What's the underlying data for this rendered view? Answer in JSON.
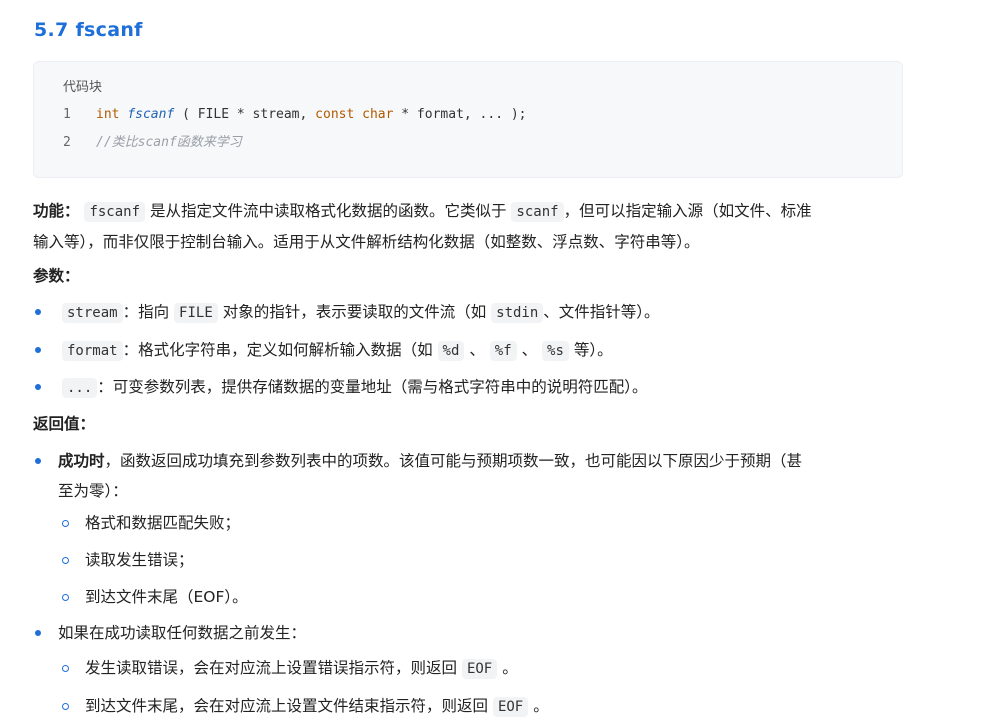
{
  "heading": "5.7 fscanf",
  "code_block": {
    "title": "代码块",
    "line1": {
      "num": "1",
      "kw1": "int",
      "fn": "fscanf",
      "rest1": " ( FILE * stream, ",
      "kw2": "const",
      "sp": " ",
      "kw3": "char",
      "rest2": " * format, ... );"
    },
    "line2": {
      "num": "2",
      "comment": "//类比scanf函数来学习"
    }
  },
  "function_para": {
    "label": "功能：",
    "code1": "fscanf",
    "text1": "是从指定文件流中读取格式化数据的函数。它类似于",
    "code2": "scanf",
    "text2": "，但可以指定输入源（如文件、标准",
    "text3": "输入等），而非仅限于控制台输入。适用于从文件解析结构化数据（如整数、浮点数、字符串等）。"
  },
  "params_heading": "参数：",
  "params": [
    {
      "code": "stream",
      "text_a": "：指向",
      "code_b": "FILE",
      "text_b": "对象的指针，表示要读取的文件流（如",
      "code_c": "stdin",
      "text_c": "、文件指针等）。"
    },
    {
      "code": "format",
      "text_a": "：格式化字符串，定义如何解析输入数据（如",
      "code_b": "%d",
      "text_b": "、",
      "code_c": "%f",
      "text_c": "、",
      "code_d": "%s",
      "text_d": "等）。"
    },
    {
      "code": "...",
      "text_a": "：可变参数列表，提供存储数据的变量地址（需与格式字符串中的说明符匹配）。"
    }
  ],
  "return_heading": "返回值：",
  "returns": {
    "success_bold": "成功时",
    "success_text1": "，函数返回成功填充到参数列表中的项数。该值可能与预期项数一致，也可能因以下原因少于预期（甚",
    "success_text2": "至为零）：",
    "sub1": [
      "格式和数据匹配失败；",
      "读取发生错误；",
      "到达文件末尾（EOF）。"
    ],
    "before_any": "如果在成功读取任何数据之前发生：",
    "sub2": [
      {
        "text": "发生读取错误，会在对应流上设置错误指示符，则返回",
        "code": "EOF",
        "tail": "。"
      },
      {
        "text": "到达文件末尾，会在对应流上设置文件结束指示符，则返回",
        "code": "EOF",
        "tail": "。"
      }
    ]
  },
  "colors": {
    "accent": "#1e6fd9",
    "code_bg": "#f7f8fa",
    "keyword": "#b05a00",
    "comment": "#9aa0a8"
  }
}
